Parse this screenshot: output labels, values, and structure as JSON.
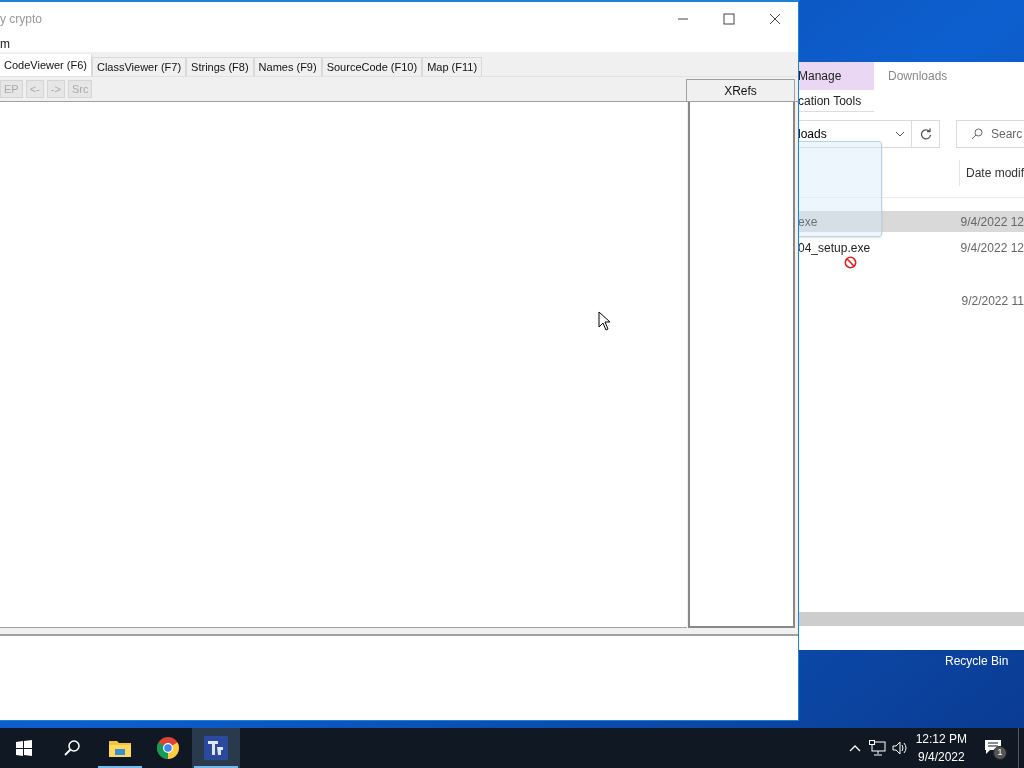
{
  "app_window": {
    "title": "y crypto",
    "menu": [
      "m"
    ],
    "tabs": [
      {
        "label": "CodeViewer (F6)",
        "selected": true
      },
      {
        "label": "ClassViewer (F7)",
        "selected": false
      },
      {
        "label": "Strings (F8)",
        "selected": false
      },
      {
        "label": "Names (F9)",
        "selected": false
      },
      {
        "label": "SourceCode (F10)",
        "selected": false
      },
      {
        "label": "Map (F11)",
        "selected": false
      }
    ],
    "toolbar": [
      {
        "label": "EP",
        "disabled": true
      },
      {
        "label": "<-",
        "disabled": true
      },
      {
        "label": "->",
        "disabled": true
      },
      {
        "label": "Src",
        "disabled": true
      }
    ],
    "xrefs_header": "XRefs"
  },
  "explorer_window": {
    "ribbon_tabs": [
      {
        "label": "Manage",
        "selected": true
      },
      {
        "label": "Downloads",
        "selected": false
      }
    ],
    "ribbon_subtitle": "cation Tools",
    "address": "loads",
    "search_placeholder": "Searc",
    "column_header": "Date modif",
    "files": [
      {
        "name": "exe",
        "date": "9/4/2022 12",
        "selected": true
      },
      {
        "name": "04_setup.exe",
        "date": "9/4/2022 12",
        "selected": false
      },
      {
        "date": "9/2/2022 11",
        "selected": false
      }
    ]
  },
  "desktop": {
    "icons": [
      "Recycle Bin"
    ]
  },
  "taskbar": {
    "apps": [
      {
        "kind": "start",
        "active": false
      },
      {
        "kind": "search",
        "active": false
      },
      {
        "kind": "folder",
        "active": false
      },
      {
        "kind": "browser",
        "active": false
      },
      {
        "kind": "app",
        "active": true
      }
    ],
    "time": "12:12 PM",
    "date": "9/4/2022",
    "notification_count": "1"
  }
}
